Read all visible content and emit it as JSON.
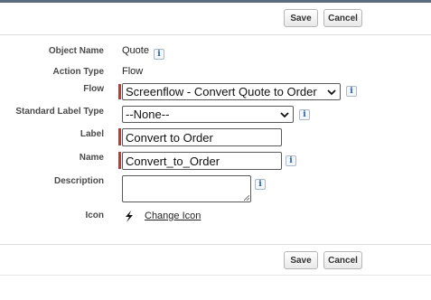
{
  "toolbar": {
    "save_label": "Save",
    "cancel_label": "Cancel"
  },
  "form": {
    "object_name": {
      "label": "Object Name",
      "value": "Quote"
    },
    "action_type": {
      "label": "Action Type",
      "value": "Flow"
    },
    "flow": {
      "label": "Flow",
      "selected": "Screenflow - Convert Quote to Order"
    },
    "standard_label_type": {
      "label": "Standard Label Type",
      "selected": "--None--"
    },
    "action_label": {
      "label": "Label",
      "value": "Convert to Order"
    },
    "api_name": {
      "label": "Name",
      "value": "Convert_to_Order"
    },
    "description": {
      "label": "Description",
      "value": ""
    },
    "icon": {
      "label": "Icon",
      "icon_name": "lightning-bolt-icon",
      "change_link": "Change Icon"
    }
  },
  "info_icon_glyph": "i",
  "colors": {
    "required_bar": "#c23934",
    "top_bar": "#5a6a80"
  }
}
